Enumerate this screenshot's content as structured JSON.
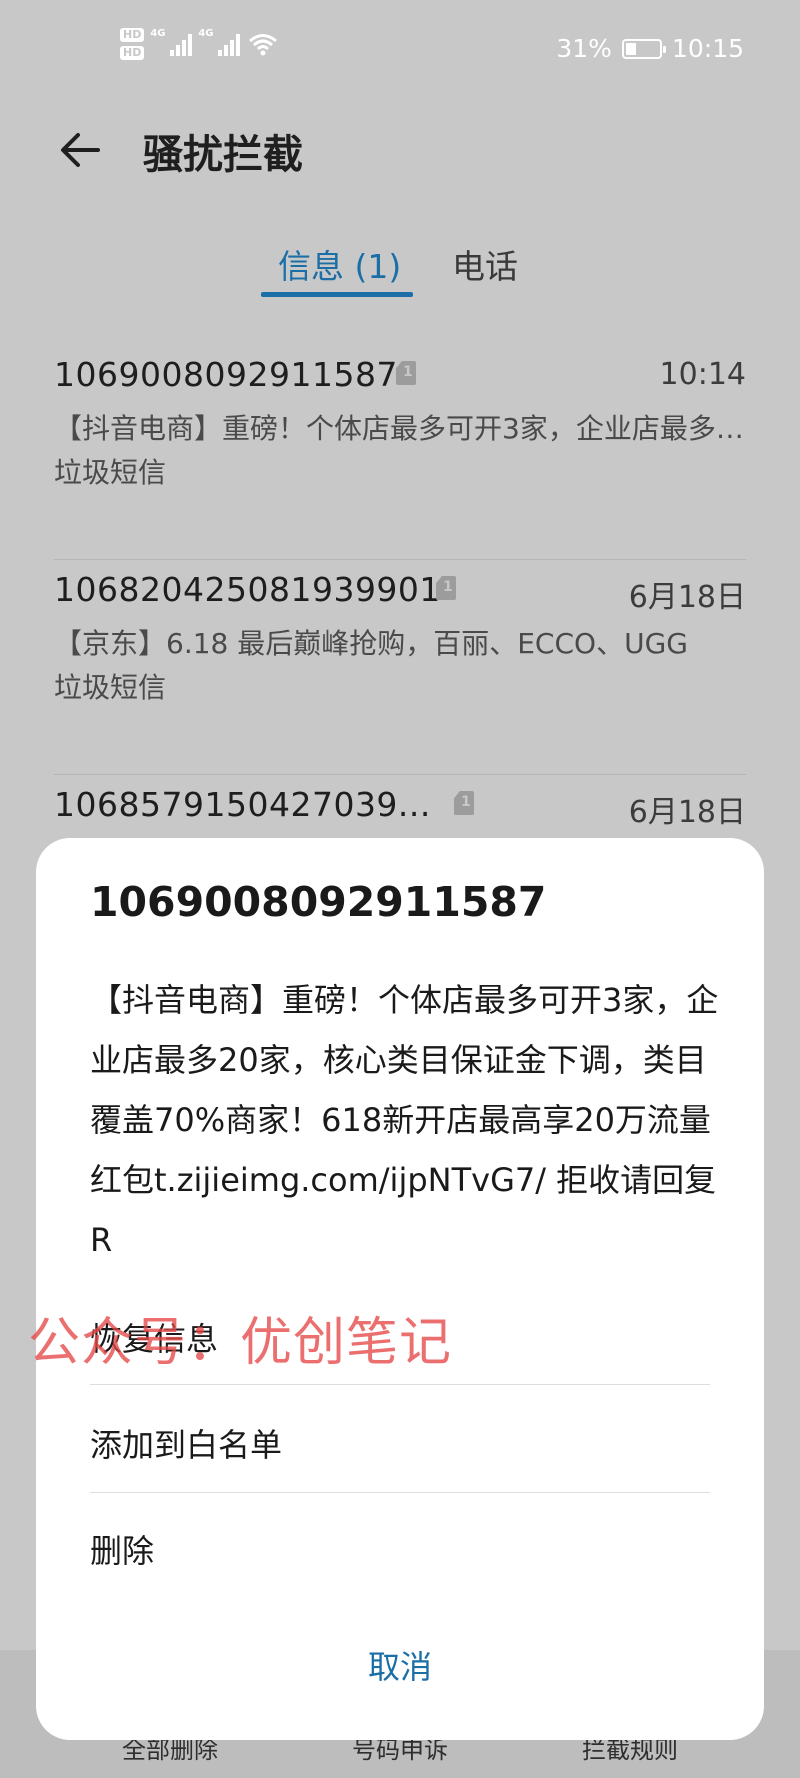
{
  "status_bar": {
    "hd1": "HD",
    "hd2": "HD",
    "sim1_net": "4G",
    "sim2_net": "4G",
    "battery": "31%",
    "battery_level": 0.31,
    "time": "10:15"
  },
  "header": {
    "title": "骚扰拦截"
  },
  "tabs": [
    {
      "label": "信息 (1)",
      "active": true
    },
    {
      "label": "电话",
      "active": false
    }
  ],
  "messages": [
    {
      "sender": "1069008092911587",
      "sim": "1",
      "time": "10:14",
      "preview": "【抖音电商】重磅！个体店最多可开3家，企业店最多20家，核心类目保证金下调",
      "tag": "垃圾短信"
    },
    {
      "sender": "106820425081939901",
      "sim": "1",
      "time": "6月18日",
      "preview": "【京东】6.18 最后巅峰抢购，百丽、ECCO、UGG",
      "tag": "垃圾短信"
    },
    {
      "sender": "1068579150427039...",
      "sim": "1",
      "time": "6月18日",
      "preview": "",
      "tag": ""
    }
  ],
  "bottom_bar": {
    "actions": [
      "全部删除",
      "号码申诉",
      "拦截规则"
    ]
  },
  "dialog": {
    "title": "1069008092911587",
    "body": "【抖音电商】重磅！个体店最多可开3家，企业店最多20家，核心类目保证金下调，类目覆盖70%商家！618新开店最高享20万流量红包t.zijieimg.com/ijpNTvG7/ 拒收请回复R",
    "options": [
      "恢复信息",
      "添加到白名单",
      "删除"
    ],
    "cancel": "取消"
  },
  "watermark": "公众号：优创笔记",
  "colors": {
    "accent": "#1b6fa6",
    "watermark": "#e64646"
  }
}
